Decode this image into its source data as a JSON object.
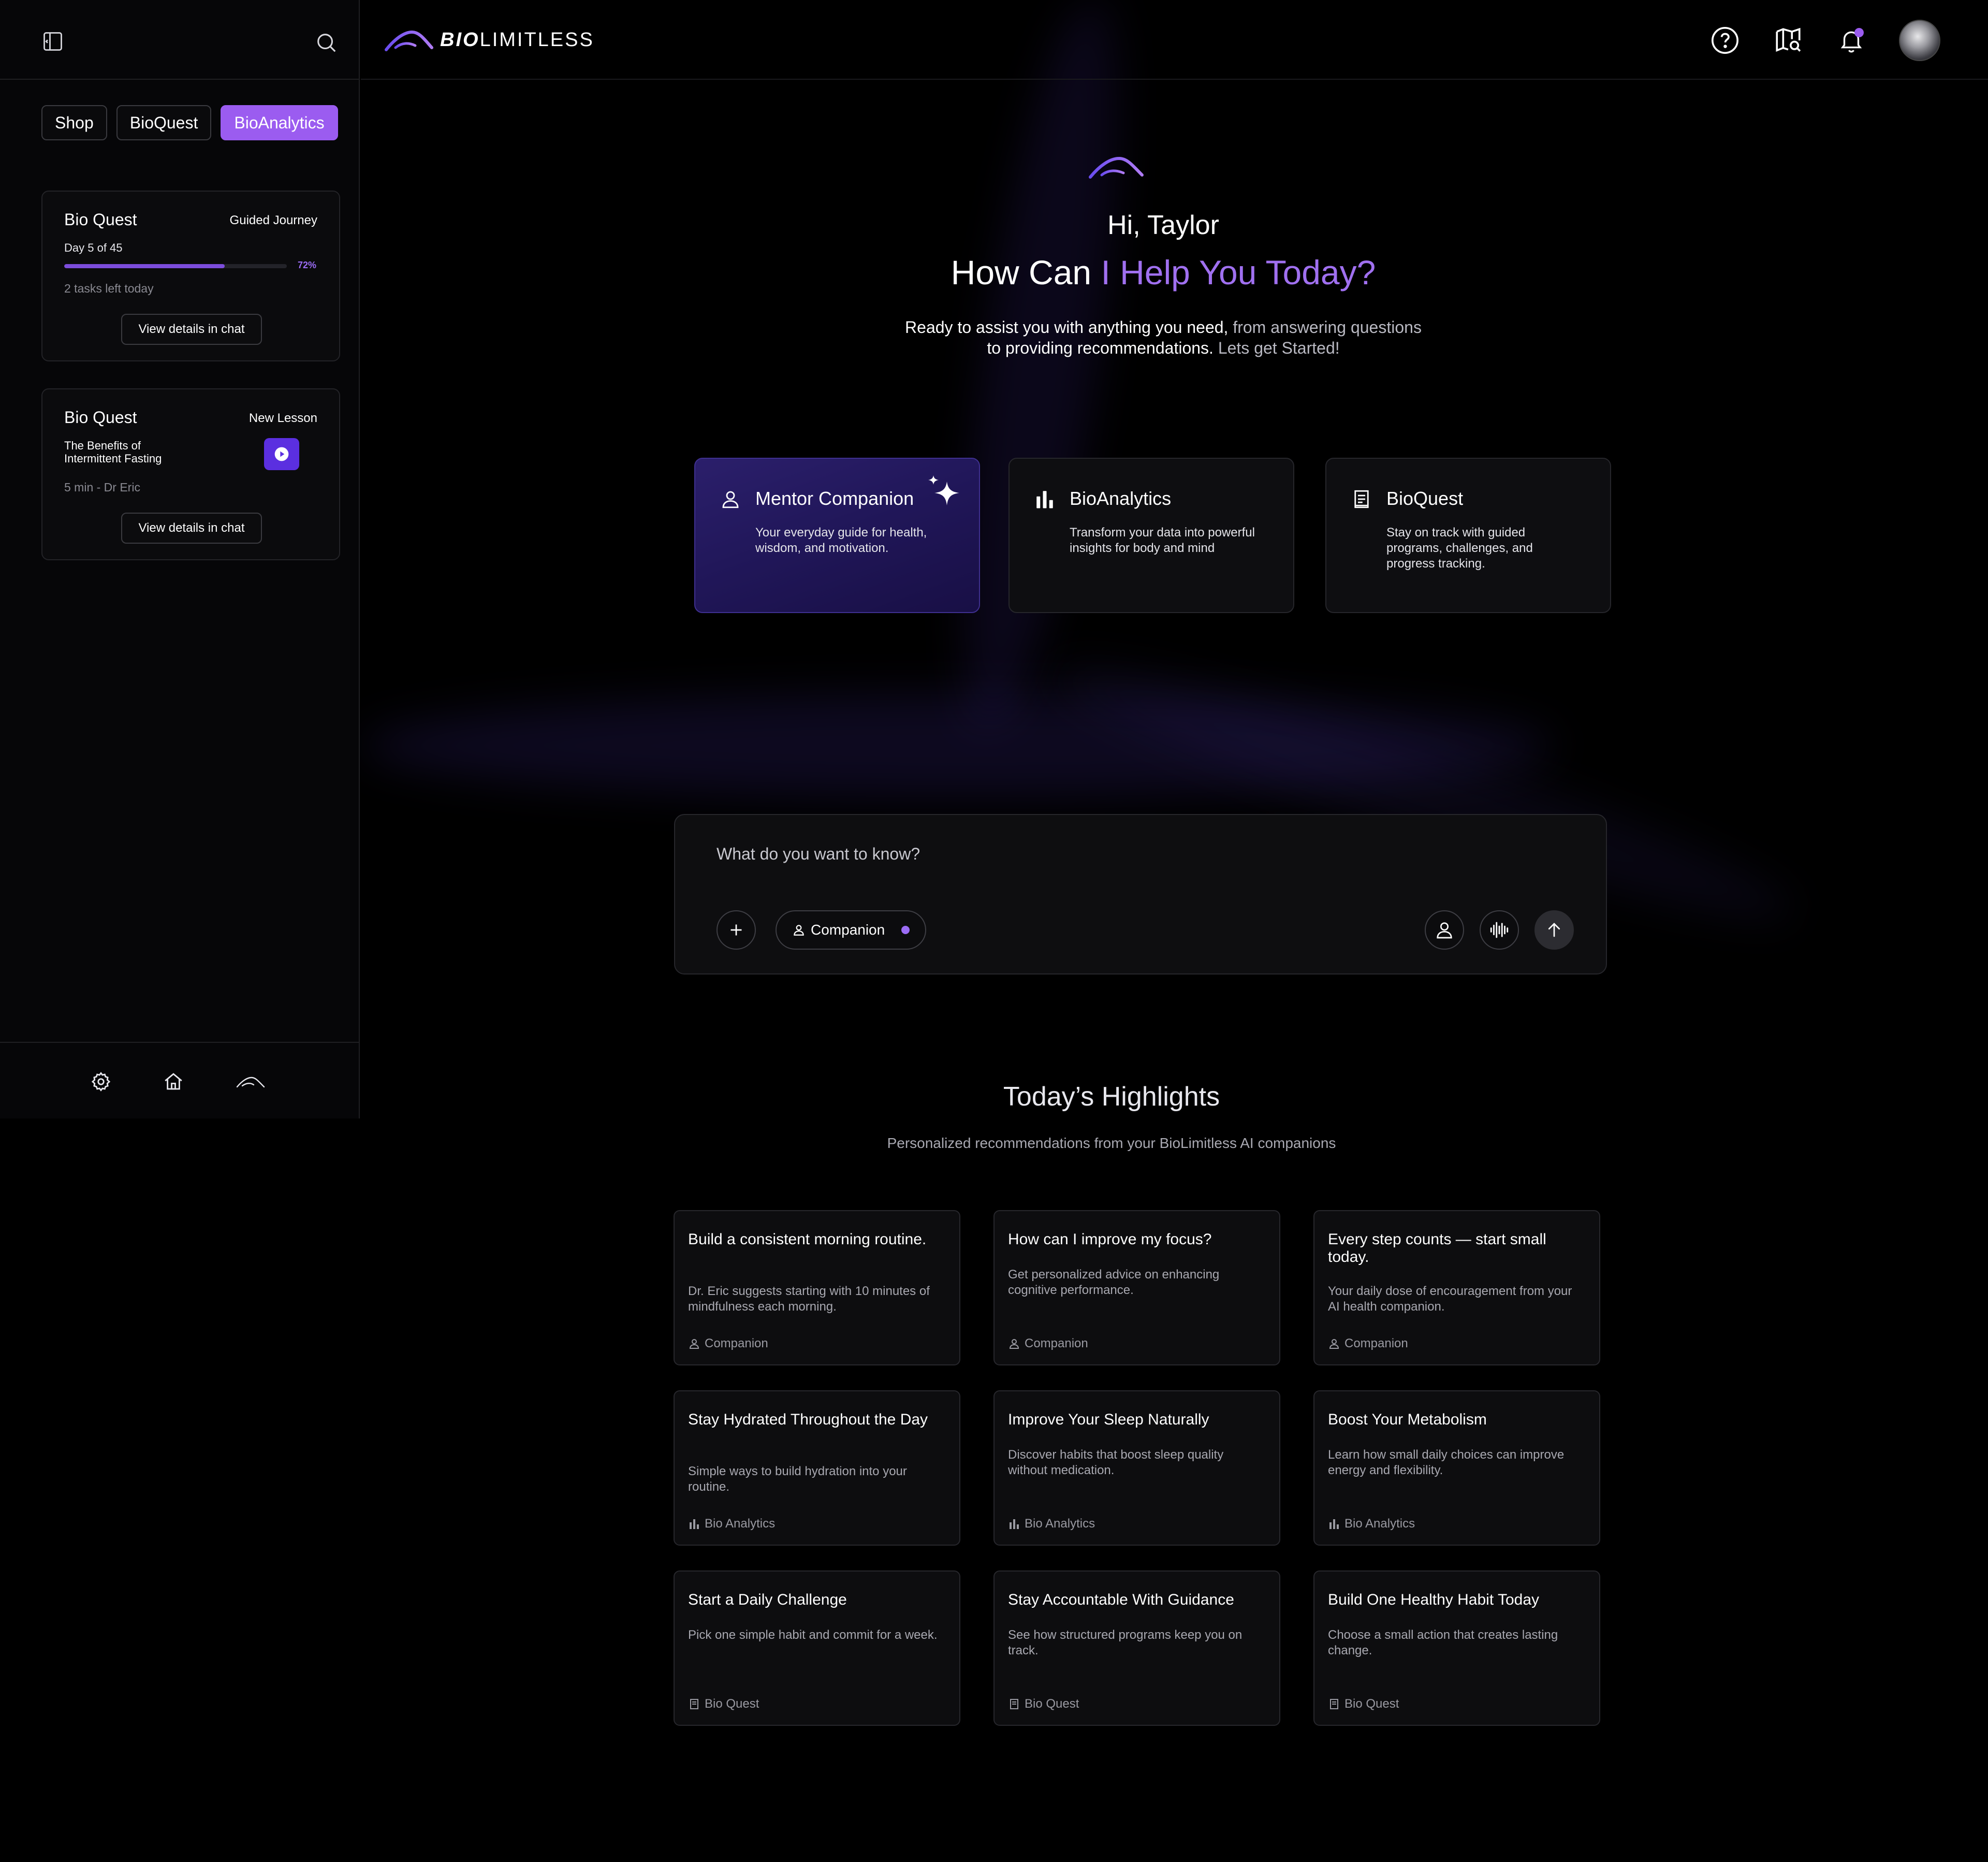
{
  "app": {
    "logo_bold": "BIO",
    "logo_light": "LIMITLESS"
  },
  "colors": {
    "accent": "#9b5cf0",
    "accent_deep": "#5b2fe0",
    "background": "#000000",
    "card": "#0d0d0f"
  },
  "sidebar": {
    "tabs": [
      {
        "label": "Shop",
        "active": false
      },
      {
        "label": "BioQuest",
        "active": false
      },
      {
        "label": "BioAnalytics",
        "active": true
      }
    ],
    "quest_card": {
      "title": "Bio Quest",
      "tag": "Guided Journey",
      "day": "Day 5 of 45",
      "progress_label": "72%",
      "progress_fraction": 0.72,
      "tasks": "2 tasks left today",
      "button": "View details in chat"
    },
    "lesson_card": {
      "title": "Bio Quest",
      "tag": "New Lesson",
      "lesson": "The Benefits of Intermittent Fasting",
      "meta": "5 min - Dr Eric",
      "button": "View details in chat"
    },
    "bottom_icons": [
      "gear-icon",
      "home-icon",
      "logo-icon"
    ]
  },
  "header": {
    "icons": [
      "help-icon",
      "map-search-icon",
      "bell-icon",
      "avatar"
    ]
  },
  "hero": {
    "greeting": "Hi, Taylor",
    "headline_plain": "How Can ",
    "headline_accent": "I Help You Today?",
    "intro_strong": "Ready to assist you with anything you need,",
    "intro_muted": " from answering questions",
    "intro_line2_strong": "to providing recommendations.",
    "intro_line2_muted": " Lets get Started!"
  },
  "features": [
    {
      "title": "Mentor Companion",
      "desc": "Your everyday guide for health, wisdom, and motivation.",
      "icon": "user-icon",
      "active": true
    },
    {
      "title": "BioAnalytics",
      "desc": "Transform your data into powerful insights for body and mind",
      "icon": "bar-chart-icon",
      "active": false
    },
    {
      "title": "BioQuest",
      "desc": "Stay on track with guided programs, challenges, and progress tracking.",
      "icon": "document-icon",
      "active": false
    }
  ],
  "chat": {
    "placeholder": "What do you want to know?",
    "mode_chip": "Companion"
  },
  "highlights": {
    "title": "Today’s Highlights",
    "subtitle": "Personalized recommendations from your BioLimitless AI companions",
    "cards": [
      {
        "title": "Build a consistent morning routine.",
        "desc": "Dr. Eric suggests starting with 10 minutes of mindfulness each morning.",
        "source": "Companion"
      },
      {
        "title": "How can I improve my focus?",
        "desc": "Get personalized advice on enhancing cognitive performance.",
        "source": "Companion"
      },
      {
        "title": "Every step counts — start small today.",
        "desc": "Your daily dose of encouragement from your AI health companion.",
        "source": "Companion"
      },
      {
        "title": "Stay Hydrated Throughout the Day",
        "desc": "Simple ways to build hydration into your routine.",
        "source": "Bio Analytics"
      },
      {
        "title": "Improve Your Sleep Naturally",
        "desc": "Discover habits that boost sleep quality without medication.",
        "source": "Bio Analytics"
      },
      {
        "title": "Boost Your Metabolism",
        "desc": "Learn how small daily choices can improve energy and flexibility.",
        "source": "Bio Analytics"
      },
      {
        "title": "Start a Daily Challenge",
        "desc": "Pick one simple habit and commit for a week.",
        "source": "Bio Quest"
      },
      {
        "title": "Stay Accountable With Guidance",
        "desc": "See how structured programs keep you on track.",
        "source": "Bio Quest"
      },
      {
        "title": "Build One Healthy Habit Today",
        "desc": "Choose a small action that creates lasting change.",
        "source": "Bio Quest"
      }
    ]
  }
}
